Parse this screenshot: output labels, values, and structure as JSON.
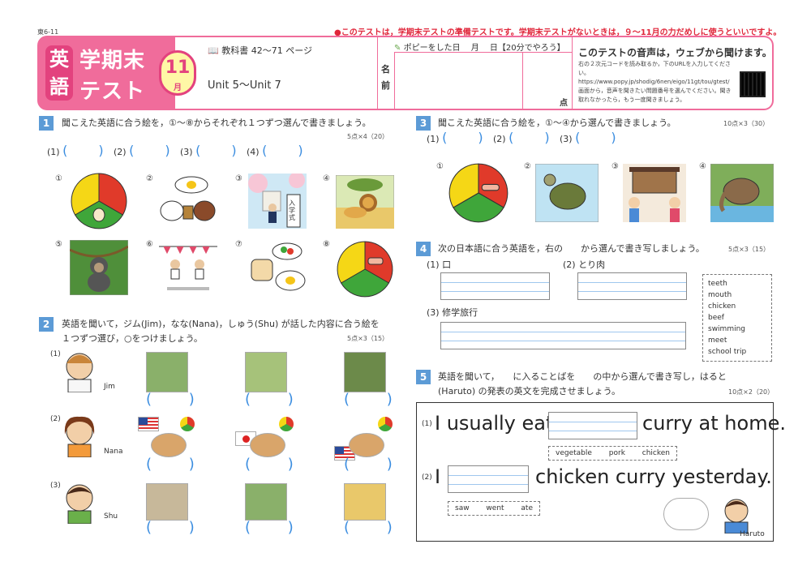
{
  "header": {
    "page_code": "東6-11",
    "notice": "●このテストは，学期末テストの準備テストです。学期末テストがないときは，９～11月の力だめしに使うといいですよ。",
    "subject_1": "英",
    "subject_2": "語",
    "title_1": "学期末",
    "title_2": "テスト",
    "month_num": "11",
    "month_unit": "月",
    "textbook": "教科書 42～71 ページ",
    "units": "Unit 5～Unit 7",
    "date_label": "ポピーをした日　 月　 日【20分でやろう】",
    "name_label": "名前",
    "score_label": "点",
    "audio_title": "このテストの音声は，ウェブから聞けます。",
    "audio_text": "右の２次元コードを読み取るか，下のURLを入力してください。https://www.popy.jp/shodig/6nen/eigo/11gt/tou/gtest/ 画面から，音声を聞きたい問題番号を選んでください。聞き取れなかったら，もう一度聞きましょう。"
  },
  "q1": {
    "num": "1",
    "text": "聞こえた英語に合う絵を，①～⑧からそれぞれ１つずつ選んで書きましょう。",
    "points": "5点×4（20）",
    "blanks": [
      "(1)",
      "(2)",
      "(3)",
      "(4)"
    ],
    "pictures": [
      "①",
      "②",
      "③",
      "④",
      "⑤",
      "⑥",
      "⑦",
      "⑧"
    ],
    "school_sign": "入学式"
  },
  "q2": {
    "num": "2",
    "text_1": "英語を聞いて，ジム(Jim)，なな(Nana)，しゅう(Shu) が話した内容に合う絵を",
    "text_2": "１つずつ選び，○をつけましょう。",
    "points": "5点×3（15）",
    "rows": [
      {
        "label": "(1)",
        "name": "Jim"
      },
      {
        "label": "(2)",
        "name": "Nana"
      },
      {
        "label": "(3)",
        "name": "Shu"
      }
    ]
  },
  "q3": {
    "num": "3",
    "text": "聞こえた英語に合う絵を，①～④から選んで書きましょう。",
    "points": "10点×3（30）",
    "blanks": [
      "(1)",
      "(2)",
      "(3)"
    ],
    "pictures": [
      "①",
      "②",
      "③",
      "④"
    ]
  },
  "q4": {
    "num": "4",
    "text": "次の日本語に合う英語を，右の　　から選んで書き写しましょう。",
    "points": "5点×3（15）",
    "items": [
      "(1) 口",
      "(2) とり肉",
      "(3) 修学旅行"
    ],
    "words": [
      "teeth",
      "mouth",
      "chicken",
      "beef",
      "swimming meet",
      "school trip"
    ]
  },
  "q5": {
    "num": "5",
    "text_1": "英語を聞いて，　　に入ることばを　　の中から選んで書き写し，はると",
    "text_2": "(Haruto) の発表の英文を完成させましょう。",
    "points": "10点×2（20）",
    "s1_label": "(1)",
    "s1_before": "I usually eat",
    "s1_after": "curry at home.",
    "s1_options": "vegetable pork chicken",
    "s2_label": "(2)",
    "s2_before": "I",
    "s2_after": "chicken curry yesterday.",
    "s2_options": "saw went ate",
    "haruto": "Haruto"
  }
}
